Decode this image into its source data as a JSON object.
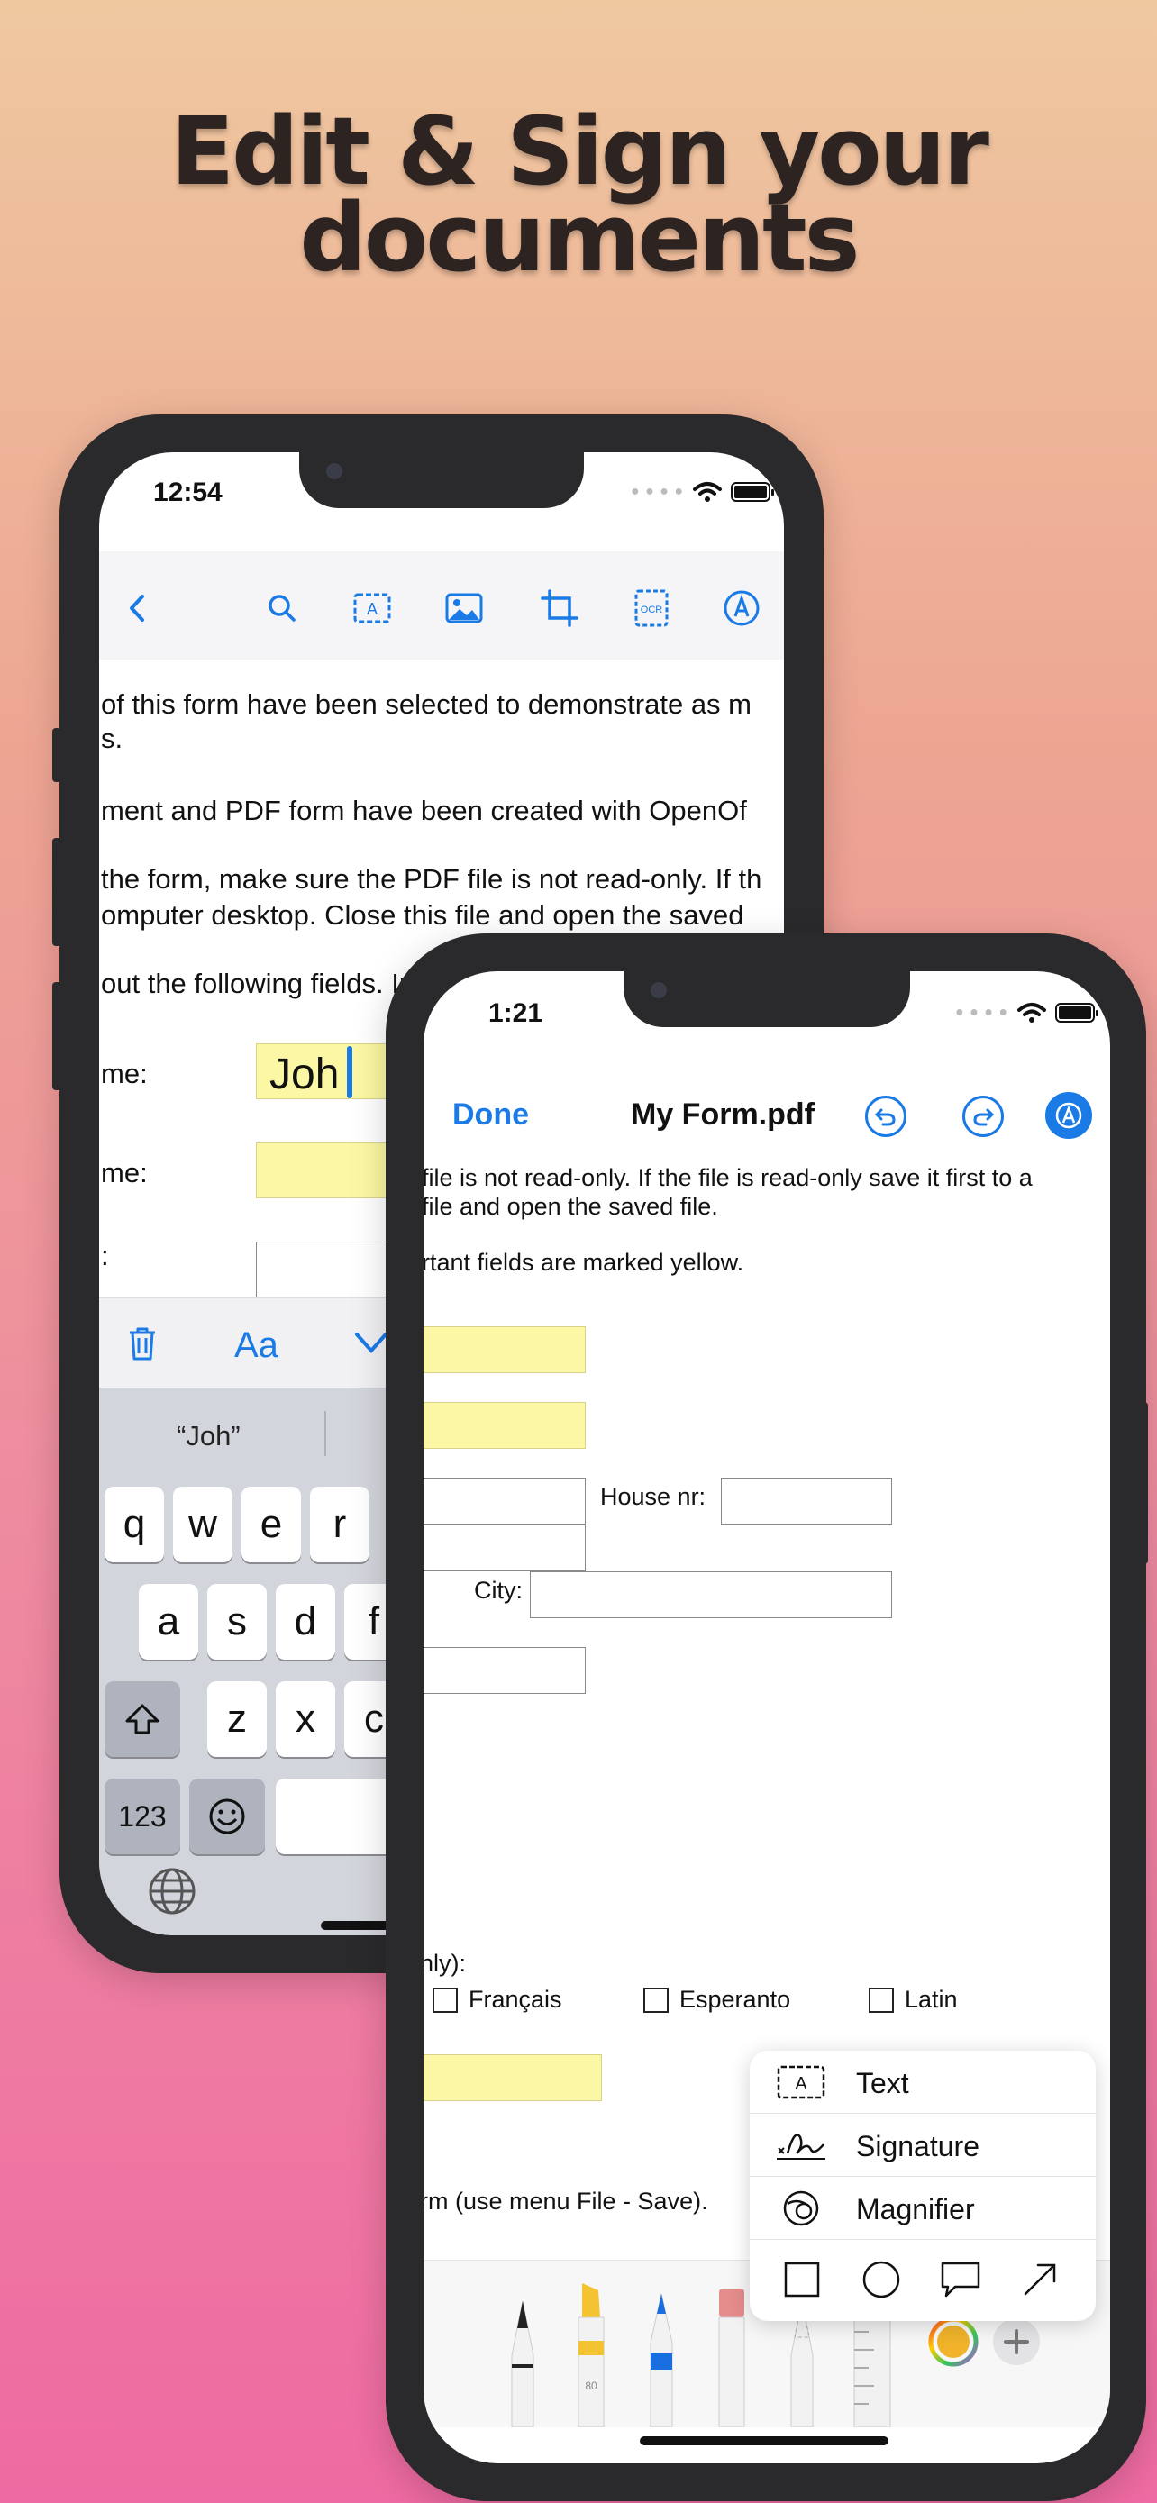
{
  "headline": {
    "line1": "Edit & Sign your",
    "line2": "documents"
  },
  "back_phone": {
    "status_time": "12:54",
    "doc_lines": [
      "of this form have been selected to demonstrate as m",
      "s.",
      "ment and PDF form have been created with OpenOf",
      "the form, make sure the PDF file is not read-only. If th",
      "omputer desktop. Close this file and open the saved",
      "out the following fields. Important fields are marked"
    ],
    "field_labels": [
      "me:",
      "me:",
      ":"
    ],
    "field_value": "Joh",
    "font_button": "Aa",
    "suggestion": "“Joh”",
    "keys_row1": [
      "q",
      "w",
      "e",
      "r"
    ],
    "keys_row2": [
      "a",
      "s",
      "d",
      "f"
    ],
    "keys_row3": [
      "z",
      "x",
      "c"
    ],
    "numbers_key": "123"
  },
  "front_phone": {
    "status_time": "1:21",
    "done_label": "Done",
    "title": "My Form.pdf",
    "doc_lines": [
      "file is not read-only. If the file is read-only save it first to a",
      "file and open the saved file.",
      "rtant fields are marked yellow."
    ],
    "house_nr_label": "House nr:",
    "city_label": "City:",
    "only_label": "nly):",
    "languages": [
      "Français",
      "Esperanto",
      "Latin"
    ],
    "save_note": "rm (use menu File - Save).",
    "menu": [
      "Text",
      "Signature",
      "Magnifier"
    ],
    "marker_label": "80"
  },
  "colors": {
    "accent": "#1a7ae6",
    "field_yellow": "#fbf7a4"
  }
}
